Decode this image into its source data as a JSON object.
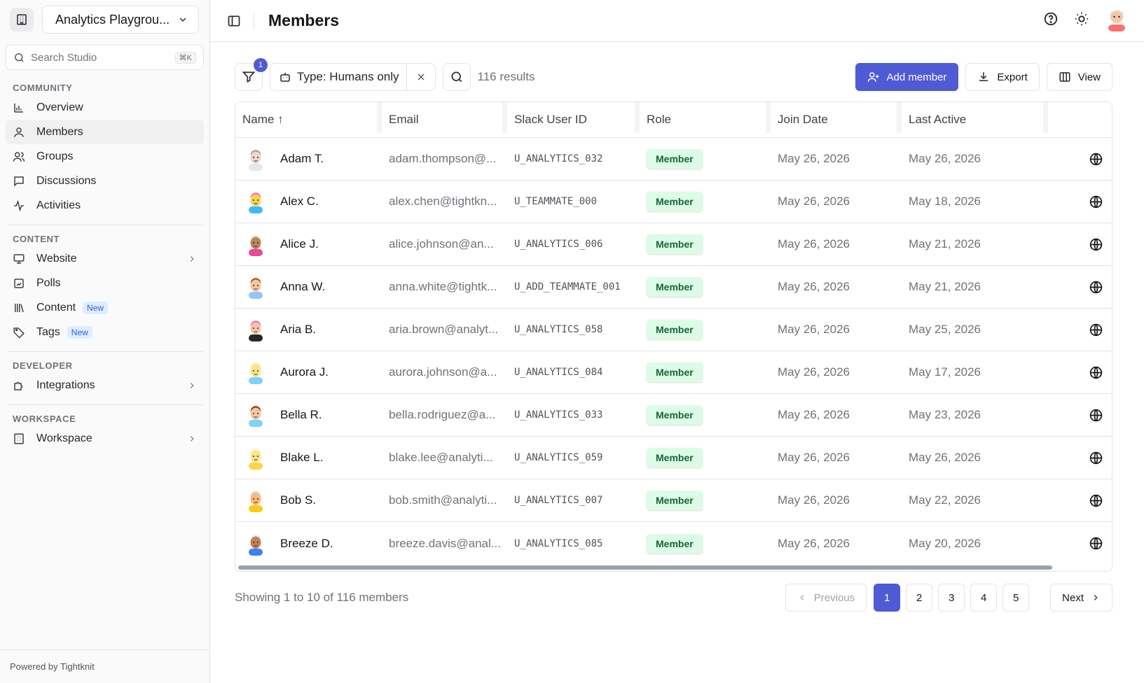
{
  "workspace": {
    "name": "Analytics Playgrou..."
  },
  "search": {
    "placeholder": "Search Studio",
    "shortcut": "⌘K"
  },
  "sidebar": {
    "sections": [
      {
        "label": "COMMUNITY",
        "items": [
          {
            "label": "Overview",
            "icon": "bar-chart-icon"
          },
          {
            "label": "Members",
            "icon": "user-icon",
            "active": true
          },
          {
            "label": "Groups",
            "icon": "users-icon"
          },
          {
            "label": "Discussions",
            "icon": "message-square-icon"
          },
          {
            "label": "Activities",
            "icon": "activity-icon"
          }
        ]
      },
      {
        "label": "CONTENT",
        "items": [
          {
            "label": "Website",
            "icon": "monitor-icon",
            "chevron": true
          },
          {
            "label": "Polls",
            "icon": "poll-icon"
          },
          {
            "label": "Content",
            "icon": "library-icon",
            "badge": "New"
          },
          {
            "label": "Tags",
            "icon": "tag-icon",
            "badge": "New"
          }
        ]
      },
      {
        "label": "DEVELOPER",
        "items": [
          {
            "label": "Integrations",
            "icon": "puzzle-icon",
            "chevron": true
          }
        ]
      },
      {
        "label": "WORKSPACE",
        "items": [
          {
            "label": "Workspace",
            "icon": "building-icon",
            "chevron": true
          }
        ]
      }
    ],
    "powered_by": "Powered by Tightknit"
  },
  "header": {
    "title": "Members"
  },
  "toolbar": {
    "filter_count": "1",
    "filter_chip": "Type: Humans only",
    "results": "116 results",
    "add_member": "Add member",
    "export": "Export",
    "view": "View"
  },
  "table": {
    "columns": [
      "Name ↑",
      "Email",
      "Slack User ID",
      "Role",
      "Join Date",
      "Last Active"
    ],
    "rows": [
      {
        "name": "Adam T.",
        "email": "adam.thompson@...",
        "slack": "U_ANALYTICS_032",
        "role": "Member",
        "join": "May 26, 2026",
        "last": "May 26, 2026",
        "avatar": {
          "skin": "#f2d5c4",
          "hair": "#9ca3af",
          "shirt": "#e5e7eb"
        }
      },
      {
        "name": "Alex C.",
        "email": "alex.chen@tightkn...",
        "slack": "U_TEAMMATE_000",
        "role": "Member",
        "join": "May 26, 2026",
        "last": "May 18, 2026",
        "avatar": {
          "skin": "#fcd34d",
          "hair": "#f472b6",
          "shirt": "#38bdf8"
        }
      },
      {
        "name": "Alice J.",
        "email": "alice.johnson@an...",
        "slack": "U_ANALYTICS_006",
        "role": "Member",
        "join": "May 26, 2026",
        "last": "May 21, 2026",
        "avatar": {
          "skin": "#c08457",
          "hair": "#e5e7eb",
          "shirt": "#ec4899"
        }
      },
      {
        "name": "Anna W.",
        "email": "anna.white@tightk...",
        "slack": "U_ADD_TEAMMATE_001",
        "role": "Member",
        "join": "May 26, 2026",
        "last": "May 21, 2026",
        "avatar": {
          "skin": "#f5c6a5",
          "hair": "#a16207",
          "shirt": "#93c5fd"
        }
      },
      {
        "name": "Aria B.",
        "email": "aria.brown@analyt...",
        "slack": "U_ANALYTICS_058",
        "role": "Member",
        "join": "May 26, 2026",
        "last": "May 25, 2026",
        "avatar": {
          "skin": "#f5c6a5",
          "hair": "#f472b6",
          "shirt": "#27272a"
        }
      },
      {
        "name": "Aurora J.",
        "email": "aurora.johnson@a...",
        "slack": "U_ANALYTICS_084",
        "role": "Member",
        "join": "May 26, 2026",
        "last": "May 17, 2026",
        "avatar": {
          "skin": "#fde68a",
          "hair": "#fde68a",
          "shirt": "#7dd3fc"
        }
      },
      {
        "name": "Bella R.",
        "email": "bella.rodriguez@a...",
        "slack": "U_ANALYTICS_033",
        "role": "Member",
        "join": "May 26, 2026",
        "last": "May 23, 2026",
        "avatar": {
          "skin": "#f5c6a5",
          "hair": "#92400e",
          "shirt": "#7dd3fc"
        }
      },
      {
        "name": "Blake L.",
        "email": "blake.lee@analyti...",
        "slack": "U_ANALYTICS_059",
        "role": "Member",
        "join": "May 26, 2026",
        "last": "May 26, 2026",
        "avatar": {
          "skin": "#fde68a",
          "hair": "#fef3c7",
          "shirt": "#fcd34d"
        }
      },
      {
        "name": "Bob S.",
        "email": "bob.smith@analyti...",
        "slack": "U_ANALYTICS_007",
        "role": "Member",
        "join": "May 26, 2026",
        "last": "May 22, 2026",
        "avatar": {
          "skin": "#fdba74",
          "hair": "#d4d4d8",
          "shirt": "#facc15"
        }
      },
      {
        "name": "Breeze D.",
        "email": "breeze.davis@anal...",
        "slack": "U_ANALYTICS_085",
        "role": "Member",
        "join": "May 26, 2026",
        "last": "May 20, 2026",
        "avatar": {
          "skin": "#c08457",
          "hair": "#e5e7eb",
          "shirt": "#3b82f6"
        }
      }
    ]
  },
  "pagination": {
    "showing": "Showing 1 to 10 of 116 members",
    "previous": "Previous",
    "pages": [
      "1",
      "2",
      "3",
      "4",
      "5"
    ],
    "current": "1",
    "next": "Next"
  },
  "colors": {
    "accent": "#4f5bd5",
    "role_bg": "#dcfce7",
    "role_text": "#166534"
  }
}
